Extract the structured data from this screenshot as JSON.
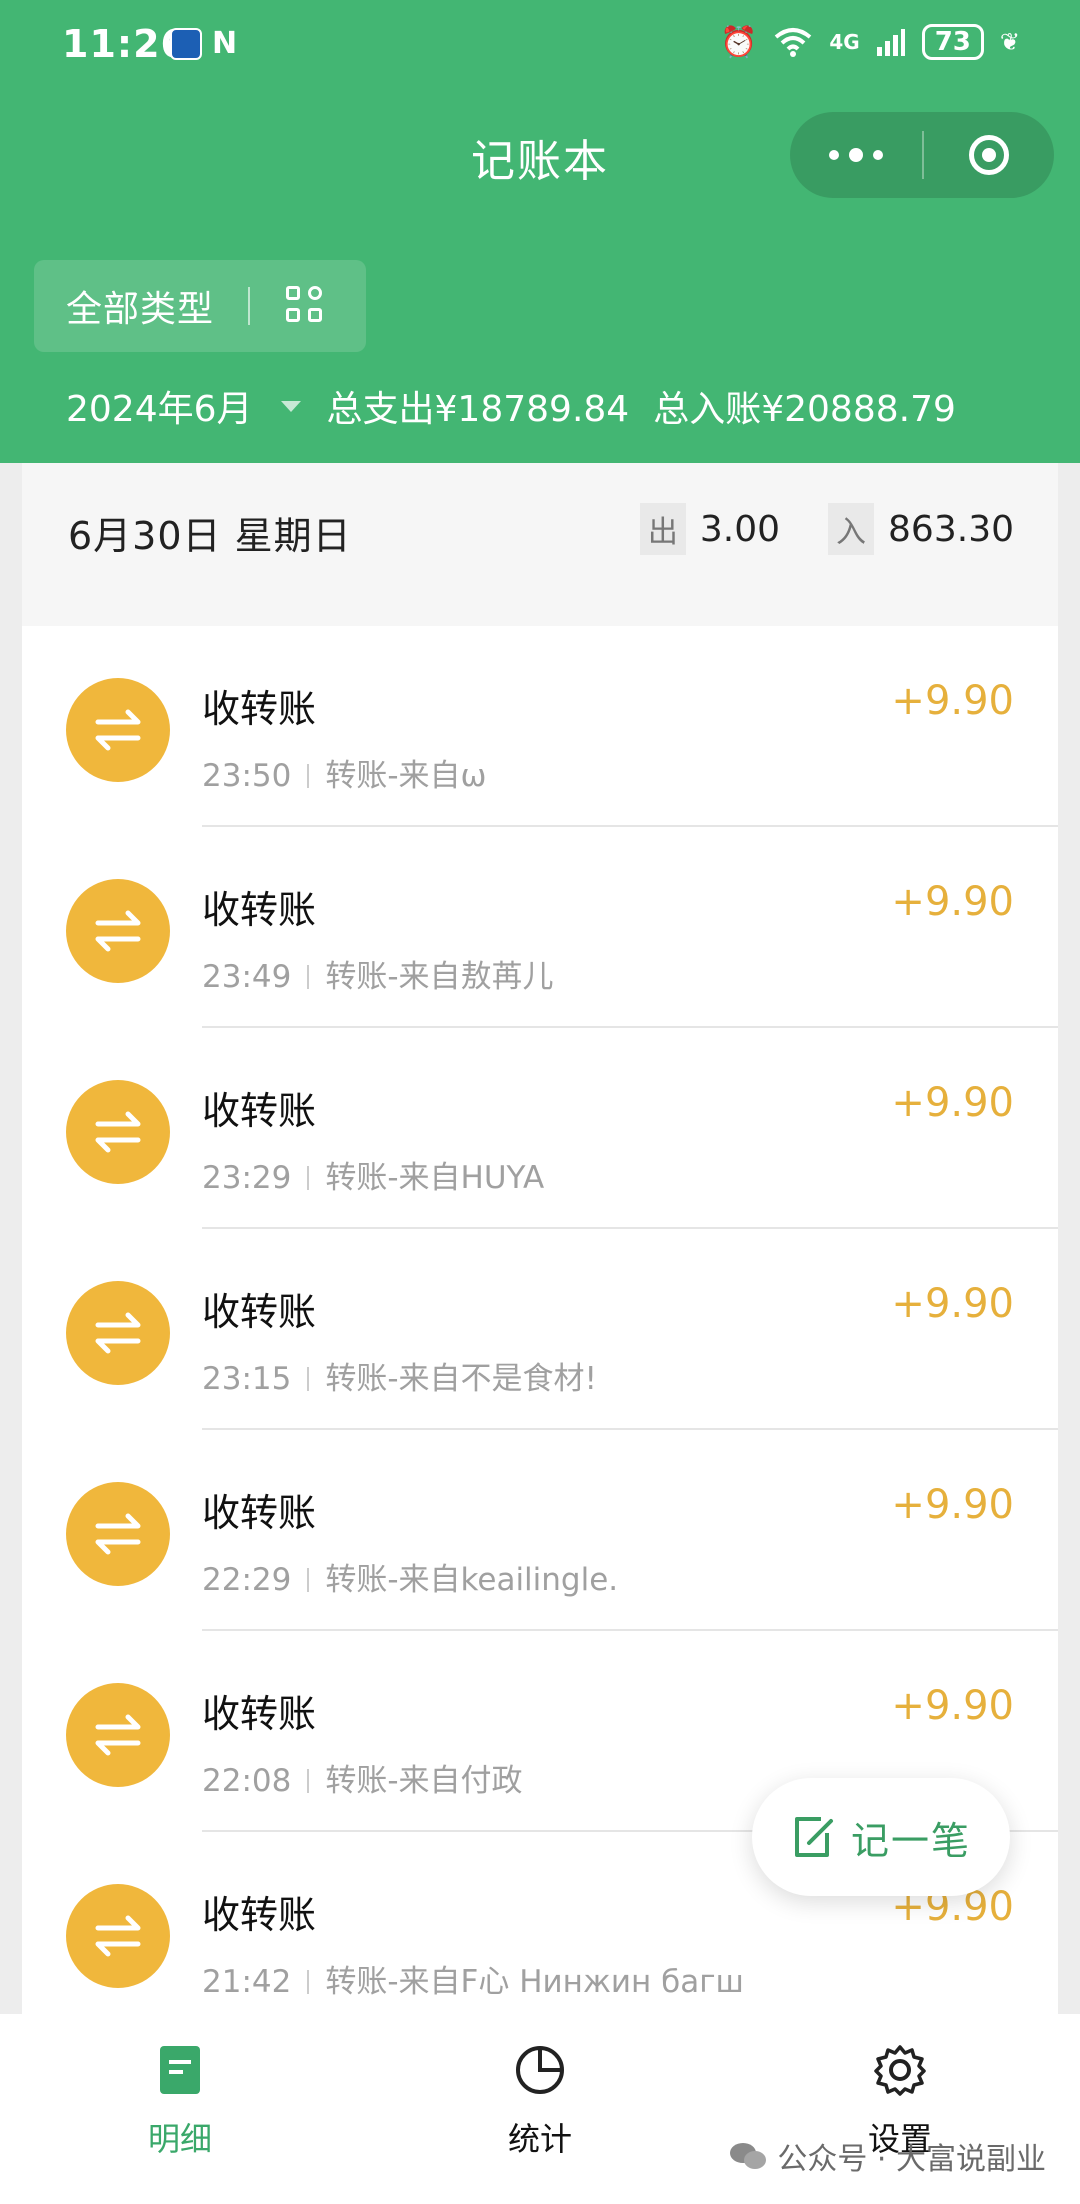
{
  "status_bar": {
    "time": "11:26",
    "nfc": "N",
    "network": "4G",
    "battery": "73"
  },
  "header": {
    "title": "记账本",
    "filter_label": "全部类型",
    "month": "2024年6月",
    "total_expense": "总支出¥18789.84",
    "total_income": "总入账¥20888.79"
  },
  "day": {
    "date": "6月30日 星期日",
    "out_label": "出",
    "out_value": "3.00",
    "in_label": "入",
    "in_value": "863.30"
  },
  "transactions": [
    {
      "title": "收转账",
      "time": "23:50",
      "note": "转账-来自ω",
      "amount": "+9.90"
    },
    {
      "title": "收转账",
      "time": "23:49",
      "note": "转账-来自敖苒儿",
      "amount": "+9.90"
    },
    {
      "title": "收转账",
      "time": "23:29",
      "note": "转账-来自HUYA",
      "amount": "+9.90"
    },
    {
      "title": "收转账",
      "time": "23:15",
      "note": "转账-来自不是食材!",
      "amount": "+9.90"
    },
    {
      "title": "收转账",
      "time": "22:29",
      "note": "转账-来自keailingle.",
      "amount": "+9.90"
    },
    {
      "title": "收转账",
      "time": "22:08",
      "note": "转账-来自付政",
      "amount": "+9.90"
    },
    {
      "title": "收转账",
      "time": "21:42",
      "note": "转账-来自F心 Нинжин багш",
      "amount": "+9.90"
    }
  ],
  "fab": {
    "label": "记一笔"
  },
  "tabs": [
    {
      "label": "明细",
      "icon": "document-icon",
      "active": true
    },
    {
      "label": "统计",
      "icon": "pie-chart-icon",
      "active": false
    },
    {
      "label": "设置",
      "icon": "gear-icon",
      "active": false
    }
  ],
  "watermark": "公众号 · 大富说副业",
  "colors": {
    "brand_green": "#43b673",
    "income_gold": "#e6b03c",
    "avatar_orange": "#f0b73c"
  }
}
